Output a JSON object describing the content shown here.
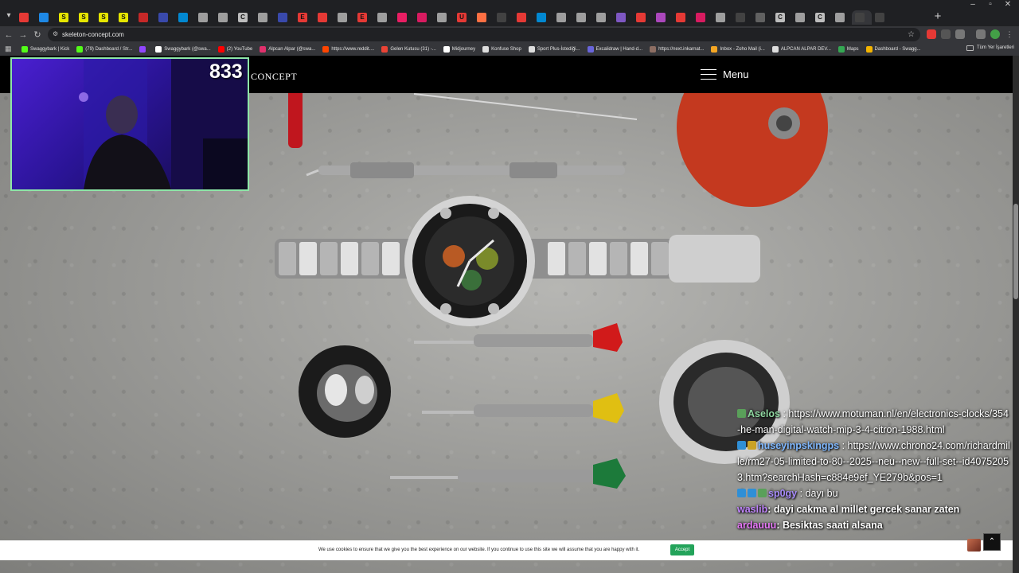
{
  "browser": {
    "tabs": [
      {
        "color": "#e53935",
        "letter": ""
      },
      {
        "color": "#1e88e5",
        "letter": ""
      },
      {
        "color": "#e6e600",
        "letter": "S"
      },
      {
        "color": "#e6e600",
        "letter": "S"
      },
      {
        "color": "#e6e600",
        "letter": "S"
      },
      {
        "color": "#e6e600",
        "letter": "S"
      },
      {
        "color": "#c62828",
        "letter": ""
      },
      {
        "color": "#3949ab",
        "letter": ""
      },
      {
        "color": "#0288d1",
        "letter": ""
      },
      {
        "color": "#9e9e9e",
        "letter": ""
      },
      {
        "color": "#9e9e9e",
        "letter": ""
      },
      {
        "color": "#bdbdbd",
        "letter": "C"
      },
      {
        "color": "#9e9e9e",
        "letter": ""
      },
      {
        "color": "#3949ab",
        "letter": ""
      },
      {
        "color": "#e53935",
        "letter": "E"
      },
      {
        "color": "#e53935",
        "letter": ""
      },
      {
        "color": "#9e9e9e",
        "letter": ""
      },
      {
        "color": "#e53935",
        "letter": "E"
      },
      {
        "color": "#9e9e9e",
        "letter": ""
      },
      {
        "color": "#e91e63",
        "letter": ""
      },
      {
        "color": "#d81b60",
        "letter": ""
      },
      {
        "color": "#9e9e9e",
        "letter": ""
      },
      {
        "color": "#e53935",
        "letter": "U"
      },
      {
        "color": "#ff7043",
        "letter": ""
      },
      {
        "color": "#424242",
        "letter": ""
      },
      {
        "color": "#e53935",
        "letter": ""
      },
      {
        "color": "#0288d1",
        "letter": ""
      },
      {
        "color": "#9e9e9e",
        "letter": ""
      },
      {
        "color": "#9e9e9e",
        "letter": ""
      },
      {
        "color": "#9e9e9e",
        "letter": ""
      },
      {
        "color": "#7e57c2",
        "letter": ""
      },
      {
        "color": "#e53935",
        "letter": ""
      },
      {
        "color": "#ab47bc",
        "letter": ""
      },
      {
        "color": "#e53935",
        "letter": ""
      },
      {
        "color": "#d81b60",
        "letter": ""
      },
      {
        "color": "#9e9e9e",
        "letter": ""
      },
      {
        "color": "#424242",
        "letter": ""
      },
      {
        "color": "#616161",
        "letter": ""
      },
      {
        "color": "#bdbdbd",
        "letter": "C"
      },
      {
        "color": "#9e9e9e",
        "letter": ""
      },
      {
        "color": "#bdbdbd",
        "letter": "C"
      },
      {
        "color": "#9e9e9e",
        "letter": ""
      },
      {
        "color": "#424242",
        "letter": ""
      },
      {
        "color": "#424242",
        "letter": ""
      }
    ],
    "url": "skeleton-concept.com",
    "bookmarks": [
      {
        "label": "Swaggybark | Kick",
        "color": "#53fc18"
      },
      {
        "label": "(79) Dashboard / Str...",
        "color": "#53fc18"
      },
      {
        "label": "",
        "color": "#9146ff"
      },
      {
        "label": "Swaggybark (@swa...",
        "color": "#ffffff"
      },
      {
        "label": "(2) YouTube",
        "color": "#ff0000"
      },
      {
        "label": "Alpcan Alpar (@swa...",
        "color": "#e1306c"
      },
      {
        "label": "https://www.reddit....",
        "color": "#ff4500"
      },
      {
        "label": "Gelen Kutusu (31) -...",
        "color": "#ea4335"
      },
      {
        "label": "Midjourney",
        "color": "#ffffff"
      },
      {
        "label": "Konfuse Shop",
        "color": "#dddddd"
      },
      {
        "label": "Sport Plus-İstediği...",
        "color": "#dddddd"
      },
      {
        "label": "Excalidraw | Hand-d...",
        "color": "#6965db"
      },
      {
        "label": "https://next.inkarnat...",
        "color": "#8d6e63"
      },
      {
        "label": "Inbox - Zoho Mail (i...",
        "color": "#f5a623"
      },
      {
        "label": "ALPCAN ALPAR DEV...",
        "color": "#dddddd"
      },
      {
        "label": "Maps",
        "color": "#34a853"
      },
      {
        "label": "Dashboard - Swagg...",
        "color": "#f4b400"
      }
    ],
    "all_bookmarks": "Tüm Yer İşaretleri"
  },
  "site": {
    "logo": "CONCEPT",
    "menu_label": "Menu"
  },
  "stream": {
    "viewer_count": "833",
    "chat": [
      {
        "user": "Aselos",
        "color": "#8fd6a0",
        "text": "https://www.motuman.nl/en/electronics-clocks/354-he-man-digital-watch-mip-3-4-citron-1988.html",
        "badges": [
          "#5aa05a"
        ]
      },
      {
        "user": "huseyinpskingps",
        "color": "#7fb8ff",
        "text": "https://www.chrono24.com/richardmille/rm27-05-limited-to-80--2025--neu--new--full-set--id40752053.htm?searchHash=c884e9ef_YE279b&pos=1",
        "badges": [
          "#2f8fd6",
          "#c9a227"
        ]
      },
      {
        "user": "sp0gy",
        "color": "#a78bfa",
        "text": "dayı bu",
        "badges": [
          "#2f8fd6",
          "#2f8fd6",
          "#5aa05a"
        ]
      },
      {
        "user": "waslib",
        "color": "#c084fc",
        "text": "dayi cakma al millet gercek sanar zaten",
        "badges": [],
        "bold": true
      },
      {
        "user": "ardauuu",
        "color": "#e879f9",
        "text": "Besiktas saati alsana",
        "badges": [],
        "bold": true
      }
    ]
  },
  "cookie": {
    "text": "We use cookies to ensure that we give you the best experience on our website. If you continue to use this site we will assume that you are happy with it.",
    "accept": "Accept"
  }
}
